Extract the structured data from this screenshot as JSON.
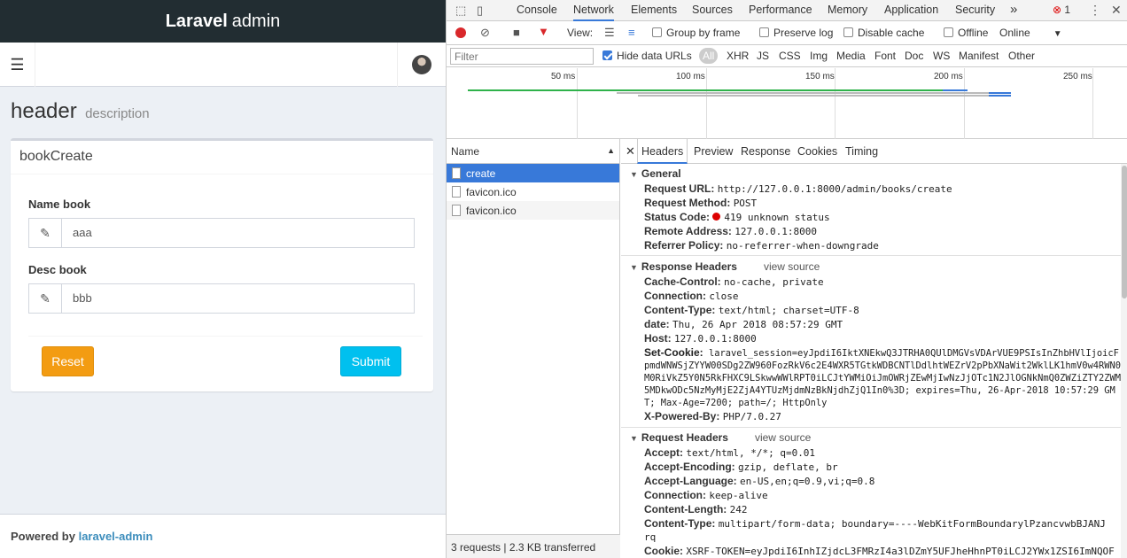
{
  "app": {
    "brand_bold": "Laravel",
    "brand_light": "admin",
    "page_header": "header",
    "page_description": "description",
    "box_title": "bookCreate",
    "fields": [
      {
        "label": "Name book",
        "value": "aaa"
      },
      {
        "label": "Desc book",
        "value": "bbb"
      }
    ],
    "reset_label": "Reset",
    "submit_label": "Submit",
    "footer_prefix": "Powered by",
    "footer_link": "laravel-admin"
  },
  "devtools": {
    "tabs": [
      "Console",
      "Network",
      "Elements",
      "Sources",
      "Performance",
      "Memory",
      "Application",
      "Security"
    ],
    "more": "»",
    "error_count": "1",
    "active_tab": "Network",
    "toolbar": {
      "view_label": "View:",
      "group_by_frame": "Group by frame",
      "preserve_log": "Preserve log",
      "disable_cache": "Disable cache",
      "offline": "Offline",
      "throttle": "Online"
    },
    "filter": {
      "placeholder": "Filter",
      "hide_data_urls": "Hide data URLs",
      "types": [
        "All",
        "XHR",
        "JS",
        "CSS",
        "Img",
        "Media",
        "Font",
        "Doc",
        "WS",
        "Manifest",
        "Other"
      ]
    },
    "timeline_ticks": [
      "50 ms",
      "100 ms",
      "150 ms",
      "200 ms",
      "250 ms"
    ],
    "name_header": "Name",
    "requests": [
      "create",
      "favicon.ico",
      "favicon.ico"
    ],
    "summary": "3 requests | 2.3 KB transferred",
    "detail_tabs": [
      "Headers",
      "Preview",
      "Response",
      "Cookies",
      "Timing"
    ],
    "general": {
      "title": "General",
      "items": [
        {
          "k": "Request URL:",
          "v": "http://127.0.0.1:8000/admin/books/create"
        },
        {
          "k": "Request Method:",
          "v": "POST"
        },
        {
          "k": "Status Code:",
          "v": "419 unknown status"
        },
        {
          "k": "Remote Address:",
          "v": "127.0.0.1:8000"
        },
        {
          "k": "Referrer Policy:",
          "v": "no-referrer-when-downgrade"
        }
      ]
    },
    "response_headers": {
      "title": "Response Headers",
      "view_source": "view source",
      "items": [
        {
          "k": "Cache-Control:",
          "v": "no-cache, private"
        },
        {
          "k": "Connection:",
          "v": "close"
        },
        {
          "k": "Content-Type:",
          "v": "text/html; charset=UTF-8"
        },
        {
          "k": "date:",
          "v": "Thu, 26 Apr 2018 08:57:29 GMT"
        },
        {
          "k": "Host:",
          "v": "127.0.0.1:8000"
        }
      ],
      "set_cookie_key": "Set-Cookie:",
      "set_cookie_value": "laravel_session=eyJpdiI6IktXNEkwQ3JTRHA0QUlDMGVsVDArVUE9PSIsInZhbHVlIjoicFpmdWNWSjZYYW00SDg2ZW960FozRkV6c2E4WXR5TGtkWDBCNTlDdlhtWEZrV2pPbXNaWit2WklLK1hmV0w4RWN0M0RiVkZ5Y0N5RkFHXC9LSkwwWWlRPT0iLCJtYWMiOiJmOWRjZEwMjIwNzJjOTc1N2JlOGNkNmQ0ZWZiZTY2ZWM5MDkwODc5NzMyMjE2ZjA4YTUzMjdmNzBkNjdhZjQ1In0%3D; expires=Thu, 26-Apr-2018 10:57:29 GMT; Max-Age=7200; path=/; HttpOnly",
      "powered_key": "X-Powered-By:",
      "powered_value": "PHP/7.0.27"
    },
    "request_headers": {
      "title": "Request Headers",
      "view_source": "view source",
      "items": [
        {
          "k": "Accept:",
          "v": "text/html, */*; q=0.01"
        },
        {
          "k": "Accept-Encoding:",
          "v": "gzip, deflate, br"
        },
        {
          "k": "Accept-Language:",
          "v": "en-US,en;q=0.9,vi;q=0.8"
        },
        {
          "k": "Connection:",
          "v": "keep-alive"
        },
        {
          "k": "Content-Length:",
          "v": "242"
        },
        {
          "k": "Content-Type:",
          "v": "multipart/form-data; boundary=----WebKitFormBoundarylPzancvwbBJANJ"
        }
      ],
      "content_type_wrap": "rq",
      "cookie_key": "Cookie:",
      "cookie_value": "XSRF-TOKEN=eyJpdiI6InhIZjdcL3FMRzI4a3lDZmY5UFJheHhnPT0iLCJ2YWx1ZSI6ImNQOF"
    }
  }
}
